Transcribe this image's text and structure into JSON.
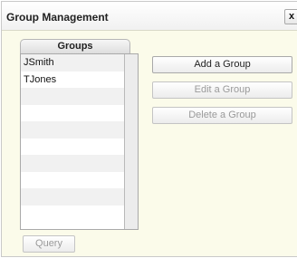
{
  "window": {
    "title": "Group Management",
    "close_label": "x"
  },
  "groups_panel": {
    "tab_label": "Groups",
    "items": [
      {
        "label": "JSmith"
      },
      {
        "label": "TJones"
      },
      {
        "label": ""
      },
      {
        "label": ""
      },
      {
        "label": ""
      },
      {
        "label": ""
      },
      {
        "label": ""
      },
      {
        "label": ""
      },
      {
        "label": ""
      },
      {
        "label": ""
      }
    ]
  },
  "actions": {
    "add_label": "Add a Group",
    "edit_label": "Edit a Group",
    "delete_label": "Delete a Group",
    "query_label": "Query"
  },
  "colors": {
    "panel_background": "#fbfbea",
    "row_alternate": "#f1f1f1",
    "disabled_text": "#9a9a9a"
  }
}
